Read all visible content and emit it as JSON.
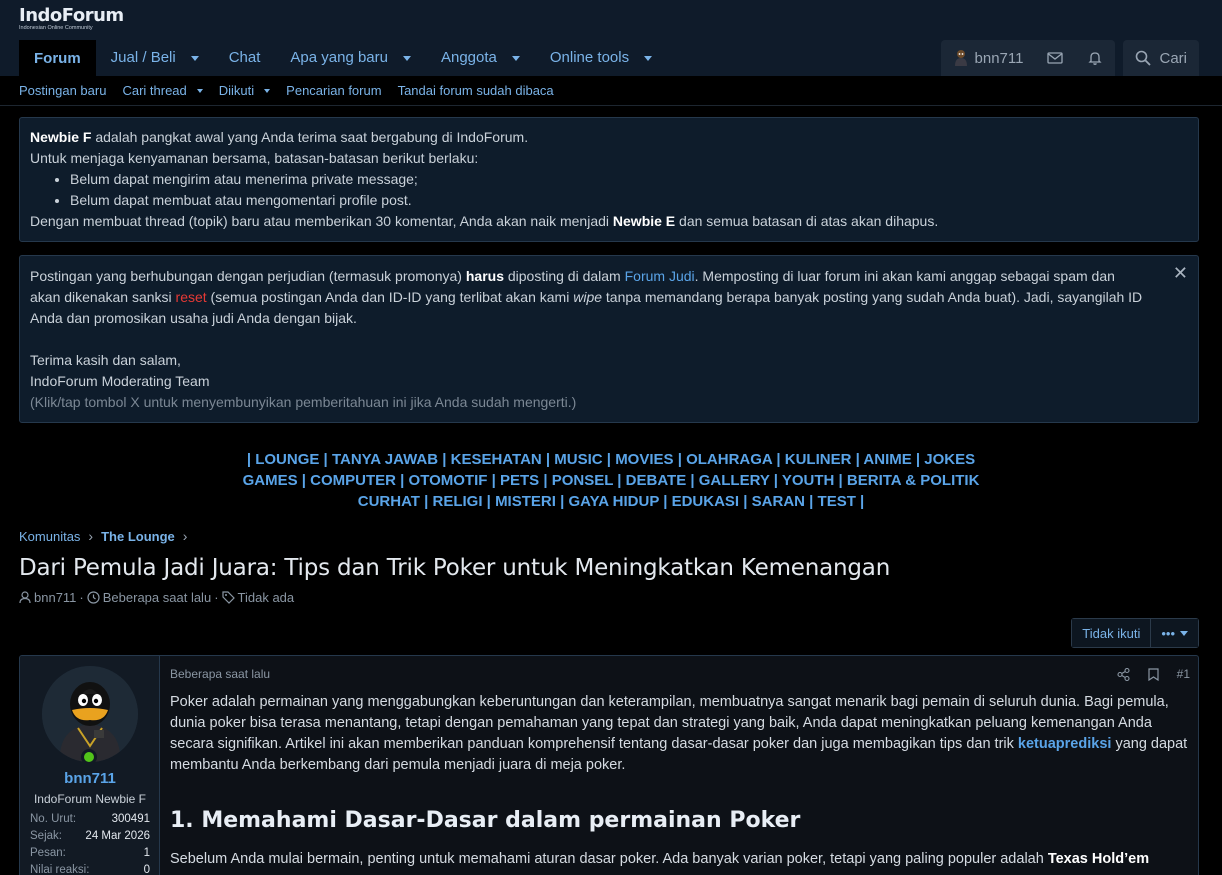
{
  "header": {
    "logo": "IndoForum",
    "logo_sub": "Indonesian Online Community"
  },
  "nav": {
    "tabs": [
      {
        "label": "Forum",
        "caret": false
      },
      {
        "label": "Jual / Beli",
        "caret": true
      },
      {
        "label": "Chat",
        "caret": false
      },
      {
        "label": "Apa yang baru",
        "caret": true
      },
      {
        "label": "Anggota",
        "caret": true
      },
      {
        "label": "Online tools",
        "caret": true
      }
    ],
    "username": "bnn711",
    "search_label": "Cari"
  },
  "subnav": {
    "items": [
      {
        "label": "Postingan baru",
        "caret": false
      },
      {
        "label": "Cari thread",
        "caret": true
      },
      {
        "label": "Diikuti",
        "caret": true
      },
      {
        "label": "Pencarian forum",
        "caret": false
      },
      {
        "label": "Tandai forum sudah dibaca",
        "caret": false
      }
    ]
  },
  "notice1": {
    "rank": "Newbie F",
    "line1_rest": " adalah pangkat awal yang Anda terima saat bergabung di IndoForum.",
    "line2": "Untuk menjaga kenyamanan bersama, batasan-batasan berikut berlaku:",
    "bullets": [
      "Belum dapat mengirim atau menerima private message;",
      "Belum dapat membuat atau mengomentari profile post."
    ],
    "line3_a": "Dengan membuat thread (topik) baru atau memberikan 30 komentar, Anda akan naik menjadi ",
    "line3_rank": "Newbie E",
    "line3_b": " dan semua batasan di atas akan dihapus."
  },
  "notice2": {
    "p1_a": "Postingan yang berhubungan dengan perjudian (termasuk promonya) ",
    "p1_bold": "harus",
    "p1_b": " diposting di dalam ",
    "p1_link": "Forum Judi",
    "p1_c": ". Memposting di luar forum ini akan kami anggap sebagai spam dan akan dikenakan sanksi ",
    "p1_red": "reset",
    "p1_d": " (semua postingan Anda dan ID-ID yang terlibat akan kami ",
    "p1_italic": "wipe",
    "p1_e": " tanpa memandang berapa banyak posting yang sudah Anda buat). Jadi, sayangilah ID Anda dan promosikan usaha judi Anda dengan bijak.",
    "thanks": "Terima kasih dan salam,",
    "team": "IndoForum Moderating Team",
    "hint": "(Klik/tap tombol X untuk menyembunyikan pemberitahuan ini jika Anda sudah mengerti.)",
    "close": "✕"
  },
  "category_lines": [
    [
      "LOUNGE",
      "TANYA JAWAB",
      "KESEHATAN",
      "MUSIC",
      "MOVIES",
      "OLAHRAGA",
      "KULINER",
      "ANIME",
      "JOKES"
    ],
    [
      "GAMES",
      "COMPUTER",
      "OTOMOTIF",
      "PETS",
      "PONSEL",
      "DEBATE",
      "GALLERY",
      "YOUTH",
      "BERITA & POLITIK"
    ],
    [
      "CURHAT",
      "RELIGI",
      "MISTERI",
      "GAYA HIDUP",
      "EDUKASI",
      "SARAN",
      "TEST"
    ]
  ],
  "breadcrumb": {
    "items": [
      "Komunitas",
      "The Lounge"
    ]
  },
  "thread": {
    "title": "Dari Pemula Jadi Juara: Tips dan Trik Poker untuk Meningkatkan Kemenangan",
    "author": "bnn711",
    "time": "Beberapa saat lalu",
    "tags": "Tidak ada",
    "unfollow": "Tidak ikuti",
    "more": "•••"
  },
  "post": {
    "user": {
      "name": "bnn711",
      "title": "IndoForum Newbie F",
      "stats": [
        {
          "k": "No. Urut:",
          "v": "300491"
        },
        {
          "k": "Sejak:",
          "v": "24 Mar 2026"
        },
        {
          "k": "Pesan:",
          "v": "1"
        },
        {
          "k": "Nilai reaksi:",
          "v": "0"
        }
      ]
    },
    "time": "Beberapa saat lalu",
    "number": "#1",
    "para1_a": "Poker adalah permainan yang menggabungkan keberuntungan dan keterampilan, membuatnya sangat menarik bagi pemain di seluruh dunia. Bagi pemula, dunia poker bisa terasa menantang, tetapi dengan pemahaman yang tepat dan strategi yang baik, Anda dapat meningkatkan peluang kemenangan Anda secara signifikan. Artikel ini akan memberikan panduan komprehensif tentang dasar-dasar poker dan juga membagikan tips dan trik ",
    "para1_link": "ketuaprediksi",
    "para1_b": " yang dapat membantu Anda berkembang dari pemula menjadi juara di meja poker.",
    "heading1": "1. Memahami Dasar-Dasar dalam permainan Poker",
    "para2_a": "Sebelum Anda mulai bermain, penting untuk memahami aturan dasar poker. Ada banyak varian poker, tetapi yang paling populer adalah ",
    "para2_bold": "Texas Hold’em"
  },
  "colors": {
    "accent": "#5aa4e8",
    "header_bg": "#0f1b2a",
    "notice_bg": "#0e1c2b",
    "online": "#52c41a",
    "red": "#e53935"
  }
}
